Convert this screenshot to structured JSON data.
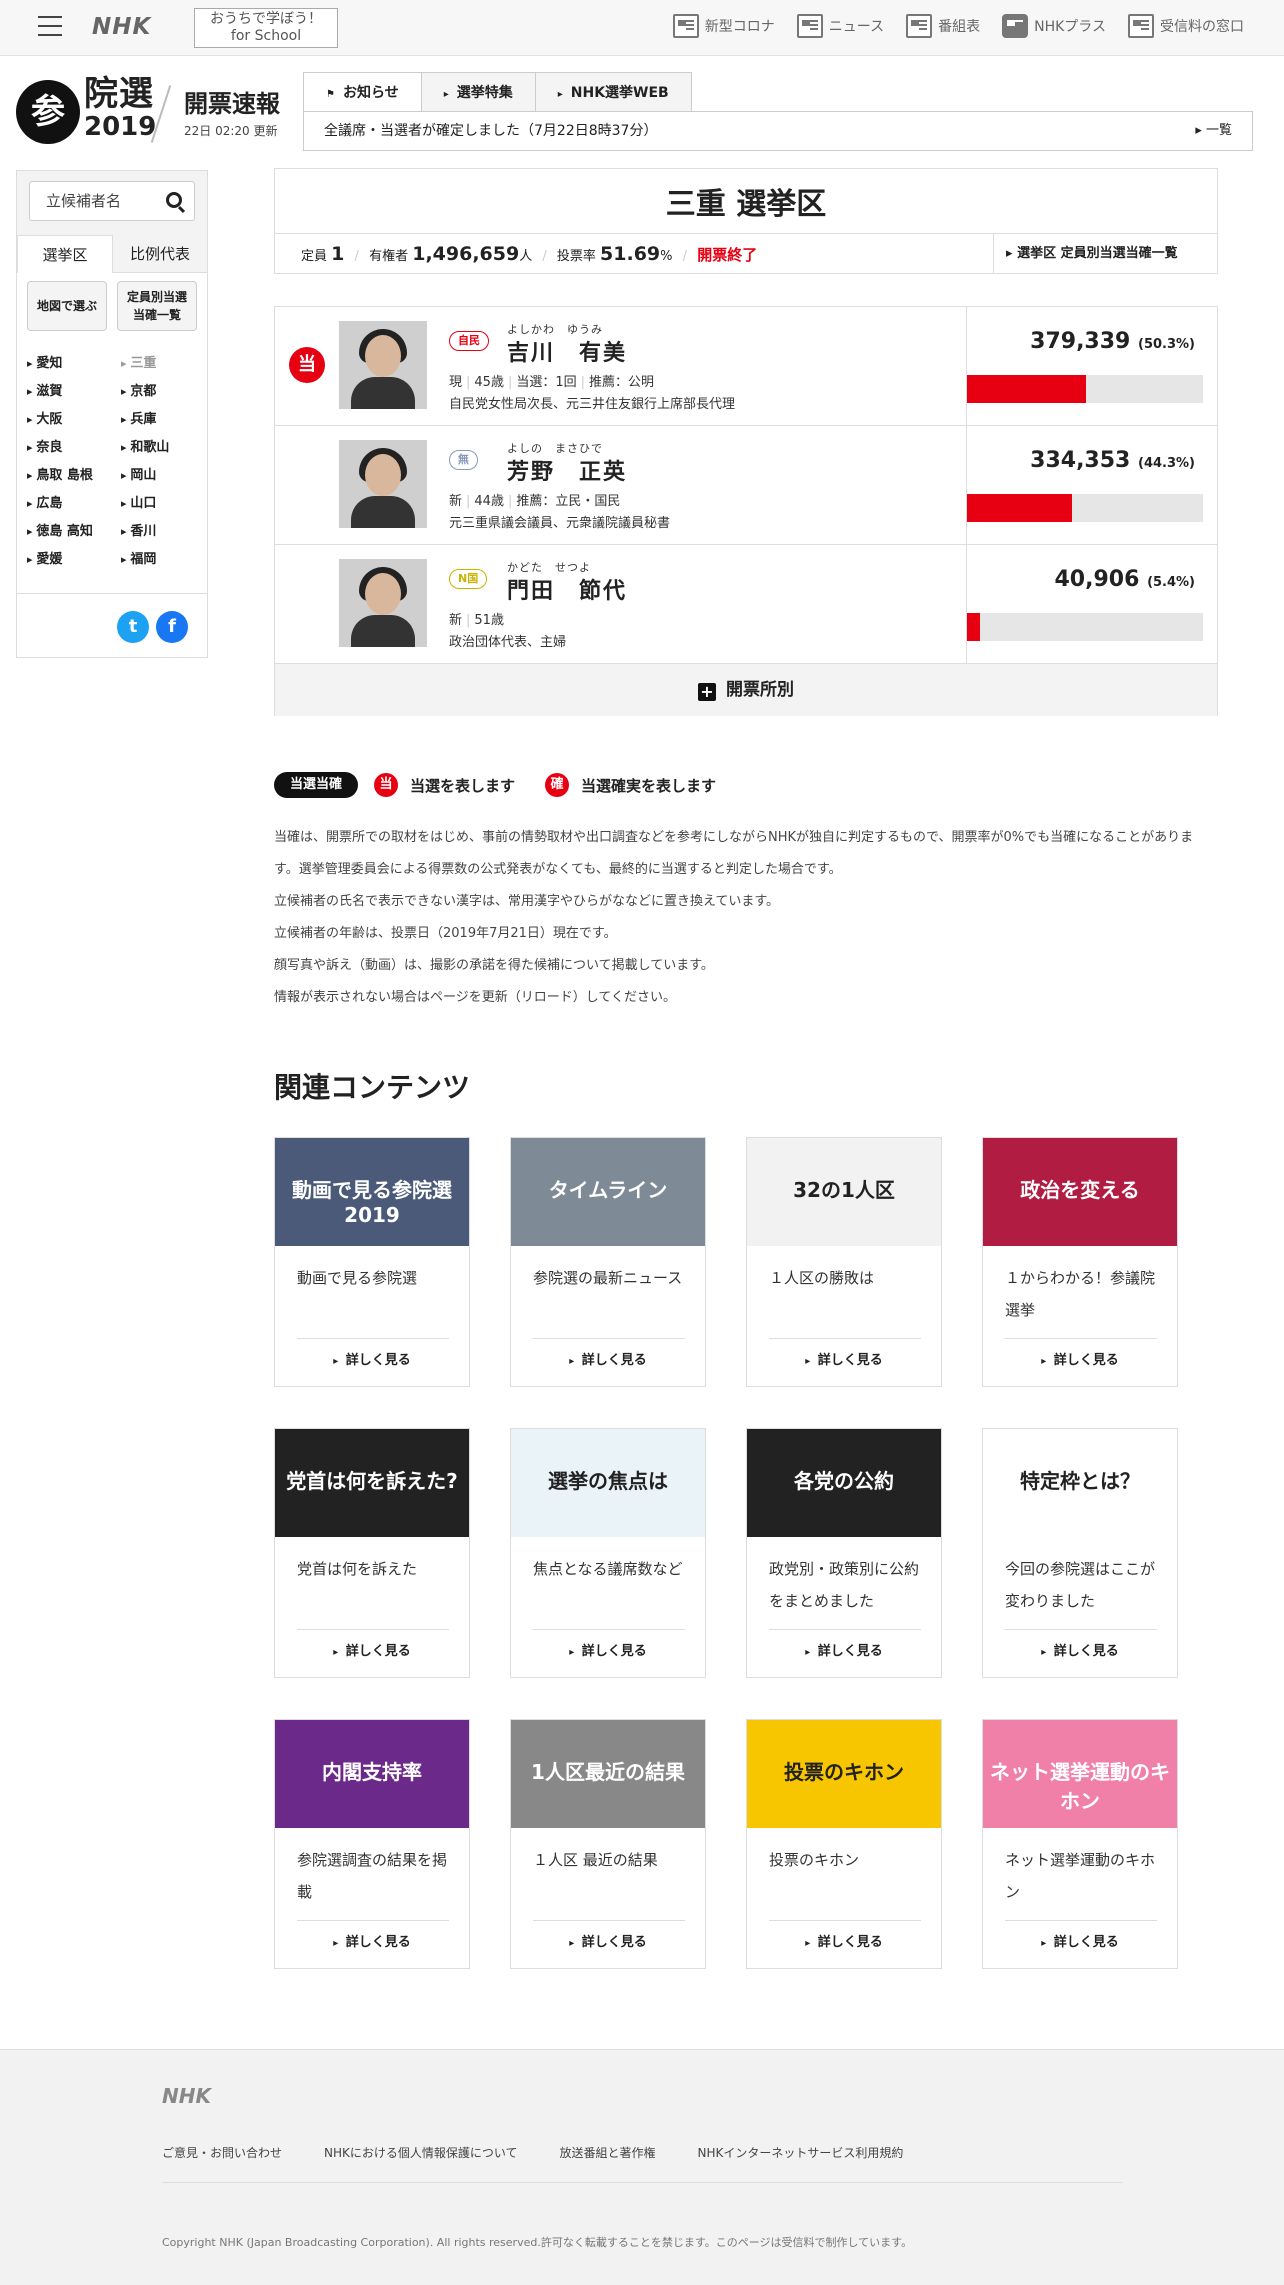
{
  "header": {
    "logo": "NHK",
    "school_line1": "おうちで学ぼう！",
    "school_line2": "for School",
    "nav": [
      "新型コロナ",
      "ニュース",
      "番組表",
      "NHKプラス",
      "受信料の窓口"
    ]
  },
  "election": {
    "logo_char": "参",
    "title": "院選",
    "year": "2019",
    "kaihyo": "開票速報",
    "updated": "22日 02:20 更新",
    "tabs": [
      "お知らせ",
      "選挙特集",
      "NHK選挙WEB"
    ],
    "notice": "全議席・当選者が確定しました（7月22日8時37分）",
    "notice_more": "一覧"
  },
  "sidebar": {
    "search_placeholder": "立候補者名",
    "tabs": [
      "選挙区",
      "比例代表"
    ],
    "btn_map": "地図で選ぶ",
    "btn_list_1": "定員別当選",
    "btn_list_2": "当確一覧",
    "prefs": [
      "愛知",
      "三重",
      "滋賀",
      "京都",
      "大阪",
      "兵庫",
      "奈良",
      "和歌山",
      "鳥取 島根",
      "岡山",
      "広島",
      "山口",
      "徳島 高知",
      "香川",
      "愛媛",
      "福岡"
    ],
    "current_pref": "三重",
    "twitter_icon": "t",
    "facebook_icon": "f"
  },
  "district": {
    "name": "三重 選挙区",
    "teiin_label": "定員",
    "teiin": "1",
    "voters_label": "有権者",
    "voters": "1,496,659",
    "voters_unit": "人",
    "turnout_label": "投票率",
    "turnout": "51.69",
    "turnout_unit": "%",
    "status": "開票終了",
    "list_link": "選挙区 定員別当選当確一覧"
  },
  "candidates": [
    {
      "winner": "当",
      "party": "自民",
      "party_color": "#e60012",
      "kana": "よしかわ　ゆうみ",
      "name": "吉川　有美",
      "status": "現",
      "age": "45歳",
      "terms": "当選：1回",
      "endorse": "推薦：公明",
      "desc": "自民党女性局次長、元三井住友銀行上席部長代理",
      "votes": "379,339",
      "pct": "(50.3%)",
      "share": 0.503
    },
    {
      "winner": "",
      "party": "無",
      "party_color": "#8899bb",
      "kana": "よしの　まさひで",
      "name": "芳野　正英",
      "status": "新",
      "age": "44歳",
      "terms": "",
      "endorse": "推薦：立民・国民",
      "desc": "元三重県議会議員、元衆議院議員秘書",
      "votes": "334,353",
      "pct": "(44.3%)",
      "share": 0.443
    },
    {
      "winner": "",
      "party": "N国",
      "party_color": "#c8b400",
      "kana": "かどた　せつよ",
      "name": "門田　節代",
      "status": "新",
      "age": "51歳",
      "terms": "",
      "endorse": "",
      "desc": "政治団体代表、主婦",
      "votes": "40,906",
      "pct": "(5.4%)",
      "share": 0.054
    }
  ],
  "kaihyo_sho": "開票所別",
  "legend": {
    "pill": "当選当確",
    "win_char": "当",
    "win_text": "当選を表します",
    "sure_char": "確",
    "sure_text": "当選確実を表します"
  },
  "notes": [
    "当確は、開票所での取材をはじめ、事前の情勢取材や出口調査などを参考にしながらNHKが独自に判定するもので、開票率が0%でも当確になることがあります。選挙管理委員会による得票数の公式発表がなくても、最終的に当選すると判定した場合です。",
    "立候補者の氏名で表示できない漢字は、常用漢字やひらがななどに置き換えています。",
    "立候補者の年齢は、投票日（2019年7月21日）現在です。",
    "顔写真や訴え（動画）は、撮影の承諾を得た候補について掲載しています。",
    "情報が表示されない場合はページを更新（リロード）してください。"
  ],
  "related": {
    "title": "関連コンテンツ",
    "more": "詳しく見る",
    "cards": [
      {
        "thumb": "動画で見る参院選2019",
        "title": "動画で見る参院選",
        "bg": "#4a5a78"
      },
      {
        "thumb": "タイムライン",
        "title": "参院選の最新ニュース",
        "bg": "#7e8a96"
      },
      {
        "thumb": "32の1人区",
        "title": "１人区の勝敗は",
        "bg": "#f2f2f2"
      },
      {
        "thumb": "政治を変える",
        "title": "１からわかる！参議院選挙",
        "bg": "#b01c42"
      },
      {
        "thumb": "党首は何を訴えた?",
        "title": "党首は何を訴えた",
        "bg": "#222222"
      },
      {
        "thumb": "選挙の焦点は",
        "title": "焦点となる議席数など",
        "bg": "#e9f3f8"
      },
      {
        "thumb": "各党の公約",
        "title": "政党別・政策別に公約をまとめました",
        "bg": "#222222"
      },
      {
        "thumb": "特定枠とは？",
        "title": "今回の参院選はここが変わりました",
        "bg": "#ffffff"
      },
      {
        "thumb": "内閣支持率",
        "title": "参院選調査の結果を掲載",
        "bg": "#6b2a8a"
      },
      {
        "thumb": "1人区最近の結果",
        "title": "１人区 最近の結果",
        "bg": "#888888"
      },
      {
        "thumb": "投票のキホン",
        "title": "投票のキホン",
        "bg": "#f7c600"
      },
      {
        "thumb": "ネット選挙運動のキホン",
        "title": "ネット選挙運動のキホン",
        "bg": "#f080a8"
      }
    ]
  },
  "footer": {
    "logo": "NHK",
    "links": [
      "ご意見・お問い合わせ",
      "NHKにおける個人情報保護について",
      "放送番組と著作権",
      "NHKインターネットサービス利用規約"
    ],
    "copyright": "Copyright NHK (Japan Broadcasting Corporation). All rights reserved.許可なく転載することを禁じます。このページは受信料で制作しています。"
  }
}
